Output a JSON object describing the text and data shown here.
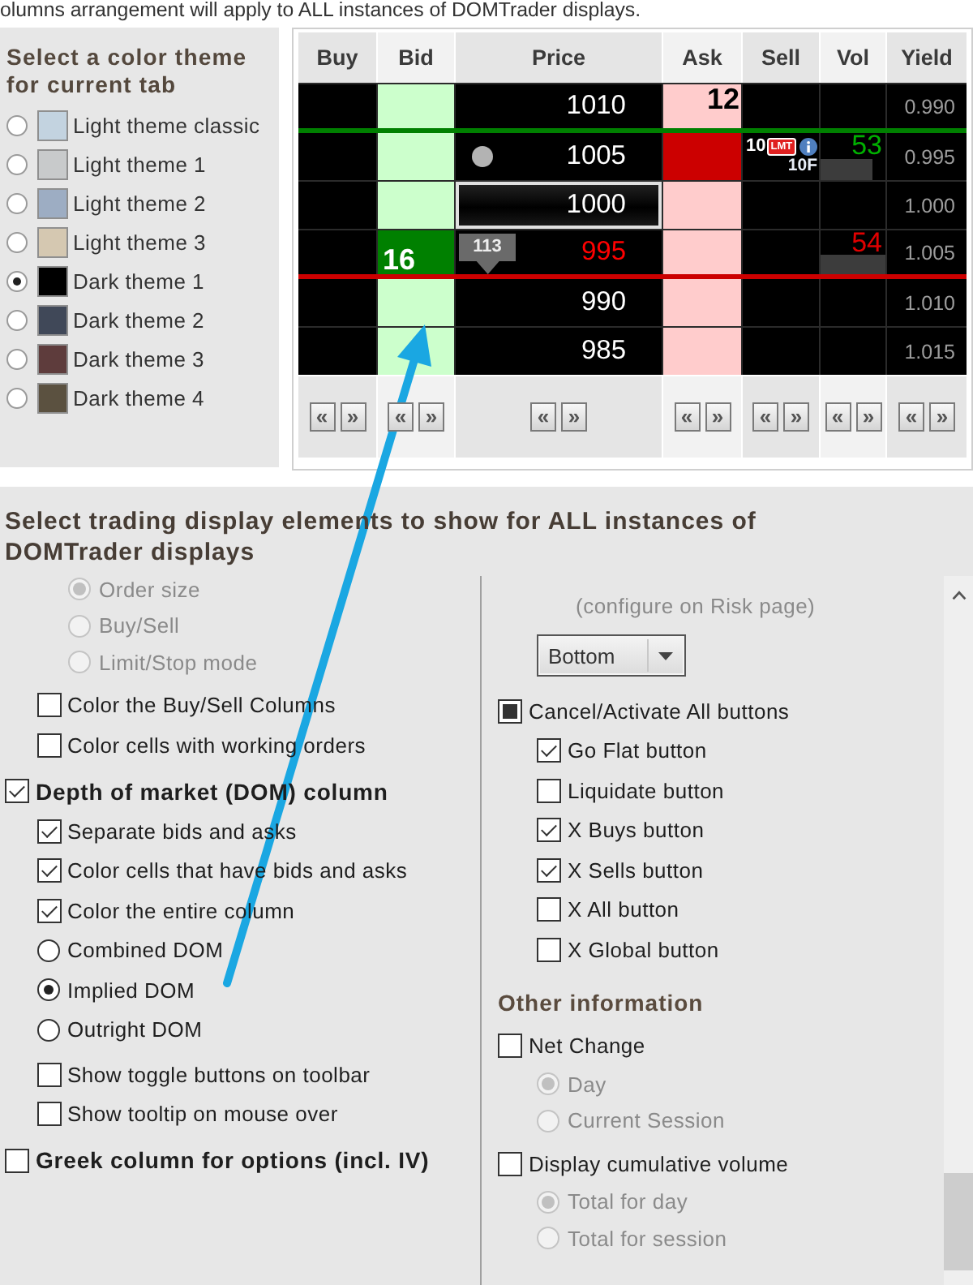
{
  "header_note": "olumns arrangement will apply to ALL instances of DOMTrader displays.",
  "theme_panel": {
    "title": "Select a color theme for current tab",
    "themes": [
      {
        "label": "Light theme classic",
        "color": "#c3d3e0",
        "selected": false
      },
      {
        "label": "Light theme 1",
        "color": "#c8cacb",
        "selected": false
      },
      {
        "label": "Light theme 2",
        "color": "#9dadc3",
        "selected": false
      },
      {
        "label": "Light theme 3",
        "color": "#d5c8b1",
        "selected": false
      },
      {
        "label": "Dark theme 1",
        "color": "#000000",
        "selected": true
      },
      {
        "label": "Dark theme 2",
        "color": "#404858",
        "selected": false
      },
      {
        "label": "Dark theme 3",
        "color": "#5e3c3c",
        "selected": false
      },
      {
        "label": "Dark theme 4",
        "color": "#5b5140",
        "selected": false
      }
    ]
  },
  "dom_preview": {
    "columns": [
      {
        "header": "Buy",
        "buttons": [
          "«",
          "»"
        ]
      },
      {
        "header": "Bid",
        "buttons": [
          "«",
          "»"
        ]
      },
      {
        "header": "Price",
        "buttons": [
          "«",
          "»"
        ]
      },
      {
        "header": "Ask",
        "buttons": [
          "«",
          "»"
        ]
      },
      {
        "header": "Sell",
        "buttons": [
          "«",
          "»"
        ]
      },
      {
        "header": "Vol",
        "buttons": [
          "«",
          "»"
        ]
      },
      {
        "header": "Yield",
        "buttons": [
          "«",
          "»"
        ]
      }
    ],
    "rows": [
      {
        "bid": {
          "highlighted": false
        },
        "price": {
          "value": "1010",
          "color": "#ffffff",
          "current": false,
          "marker": false
        },
        "ask": {
          "highlighted": false,
          "value": "12"
        },
        "yield": "0.990",
        "line_below": {
          "color": "#008000"
        }
      },
      {
        "bid": {
          "highlighted": false
        },
        "price": {
          "value": "1005",
          "color": "#ffffff",
          "current": false,
          "marker": true
        },
        "ask": {
          "highlighted": true
        },
        "sell": {
          "value": "10",
          "badge": "LMT",
          "info": true,
          "note": "10F"
        },
        "vol": {
          "value": "53",
          "up": true,
          "level": 0.8
        },
        "yield": "0.995"
      },
      {
        "bid": {
          "highlighted": false
        },
        "price": {
          "value": "1000",
          "color": "#ffffff",
          "current": true,
          "marker": false
        },
        "ask": {
          "highlighted": false
        },
        "yield": "1.000"
      },
      {
        "bid": {
          "highlighted": true,
          "value": "16"
        },
        "price": {
          "value": "995",
          "color": "#ff0000",
          "current": false,
          "marker": false,
          "tooltip": "113"
        },
        "ask": {
          "highlighted": false
        },
        "vol": {
          "value": "54",
          "up": false,
          "level": 1
        },
        "yield": "1.005",
        "line_below": {
          "color": "#cc0000"
        }
      },
      {
        "bid": {
          "highlighted": false
        },
        "price": {
          "value": "990",
          "color": "#ffffff",
          "current": false,
          "marker": false
        },
        "ask": {
          "highlighted": false
        },
        "yield": "1.010"
      },
      {
        "bid": {
          "highlighted": false
        },
        "price": {
          "value": "985",
          "color": "#ffffff",
          "current": false,
          "marker": false
        },
        "ask": {
          "highlighted": false
        },
        "yield": "1.015"
      }
    ]
  },
  "display_elements": {
    "title": "Select trading display elements to show for ALL instances of DOMTrader displays",
    "left_column": [
      {
        "children": [
          {
            "children": [
              {
                "kind": "radio",
                "label": "Order size",
                "selected": true,
                "disabled": true
              },
              {
                "kind": "radio",
                "label": "Buy/Sell",
                "selected": false,
                "disabled": true
              },
              {
                "kind": "radio",
                "label": "Limit/Stop mode",
                "selected": false,
                "disabled": true
              }
            ]
          },
          {
            "kind": "checkbox",
            "label": "Color the Buy/Sell Columns",
            "checked": false
          },
          {
            "kind": "checkbox",
            "label": "Color cells with working orders",
            "checked": false
          }
        ]
      },
      {
        "kind": "checkbox",
        "label": "Depth of market (DOM) column",
        "checked": true,
        "children": [
          {
            "kind": "checkbox",
            "label": "Separate bids and asks",
            "checked": true
          },
          {
            "kind": "checkbox",
            "label": "Color cells that have bids and asks",
            "checked": true
          },
          {
            "kind": "checkbox",
            "label": "Color the entire column",
            "checked": true
          },
          {
            "kind": "radio",
            "label": "Combined DOM",
            "selected": false,
            "disabled": false
          },
          {
            "kind": "radio",
            "label": "Implied DOM",
            "selected": true,
            "disabled": false
          },
          {
            "kind": "radio",
            "label": "Outright DOM",
            "selected": false,
            "disabled": false
          },
          {
            "kind": "checkbox",
            "label": "Show toggle buttons on toolbar",
            "checked": false
          },
          {
            "kind": "checkbox",
            "label": "Show tooltip on mouse over",
            "checked": false
          }
        ]
      },
      {
        "kind": "checkbox",
        "label": "Greek column for options (incl. IV)",
        "checked": false
      }
    ],
    "right_column": [
      {
        "children": [
          {
            "kind": "note",
            "text": "(configure on Risk page)"
          },
          {
            "kind": "dropdown",
            "value": "Bottom"
          }
        ]
      },
      {
        "kind": "checkbox",
        "label": "Cancel/Activate All buttons",
        "checked": false,
        "partial": true,
        "children": [
          {
            "kind": "checkbox",
            "label": "Go Flat button",
            "checked": true
          },
          {
            "kind": "checkbox",
            "label": "Liquidate button",
            "checked": false
          },
          {
            "kind": "checkbox",
            "label": "X Buys button",
            "checked": true
          },
          {
            "kind": "checkbox",
            "label": "X Sells button",
            "checked": true
          },
          {
            "kind": "checkbox",
            "label": "X All button",
            "checked": false
          },
          {
            "kind": "checkbox",
            "label": "X Global button",
            "checked": false
          }
        ]
      },
      {
        "kind": "heading",
        "text": "Other information"
      },
      {
        "kind": "checkbox",
        "label": "Net Change",
        "checked": false,
        "partial": false,
        "children": [
          {
            "kind": "radio",
            "label": "Day",
            "selected": true,
            "disabled": true
          },
          {
            "kind": "radio",
            "label": "Current Session",
            "selected": false,
            "disabled": true
          }
        ]
      },
      {
        "kind": "checkbox",
        "label": "Display cumulative volume",
        "checked": false,
        "partial": false,
        "children": [
          {
            "kind": "radio",
            "label": "Total for day",
            "selected": true,
            "disabled": true
          },
          {
            "kind": "radio",
            "label": "Total for session",
            "selected": false,
            "disabled": true
          }
        ]
      }
    ]
  },
  "overlay": {
    "kind": "arrow"
  }
}
